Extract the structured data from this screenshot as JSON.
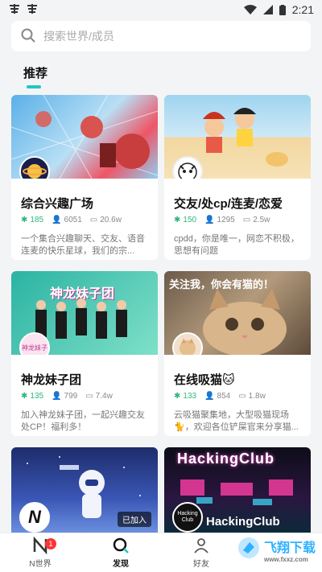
{
  "status": {
    "time": "2:21",
    "left_icons": [
      "app-icon",
      "app-icon"
    ]
  },
  "search": {
    "placeholder": "搜索世界/成员"
  },
  "section": {
    "title": "推荐"
  },
  "cards": [
    {
      "title": "综合兴趣广场",
      "members": "185",
      "users": "6051",
      "posts": "20.6w",
      "desc": "一个集合兴趣聊天、交友、语音连麦的快乐星球，我们的宗..."
    },
    {
      "title": "交友/处cp/连麦/恋爱",
      "members": "150",
      "users": "1295",
      "posts": "2.5w",
      "desc": "cpdd，你是唯一，网恋不积极，思想有问题"
    },
    {
      "title": "神龙妹子团",
      "members": "135",
      "users": "799",
      "posts": "7.4w",
      "desc": "加入神龙妹子团，一起兴趣交友处CP！福利多！",
      "banner": "神龙妹子团",
      "avatar_text": "神龙妹子"
    },
    {
      "title": "在线吸猫🐱",
      "members": "133",
      "users": "854",
      "posts": "1.8w",
      "desc": "云吸猫聚集地，大型吸猫现场🐈，欢迎各位铲屎官来分享猫...",
      "banner": "关注我，你会有猫的！"
    },
    {
      "joined": "已加入",
      "avatar_text": "N"
    },
    {
      "banner": "HackingClub",
      "banner2": "HackingClub",
      "avatar_text": "Hacking Club"
    }
  ],
  "nav": {
    "items": [
      {
        "label": "N世界",
        "badge": "1"
      },
      {
        "label": "发现"
      },
      {
        "label": "好友"
      }
    ]
  },
  "watermark": {
    "text": "飞翔下载",
    "sub": "www.fxxz.com"
  },
  "colors": {
    "accent": "#1fc8c0",
    "green": "#2db67c",
    "badge": "#ff3333"
  }
}
